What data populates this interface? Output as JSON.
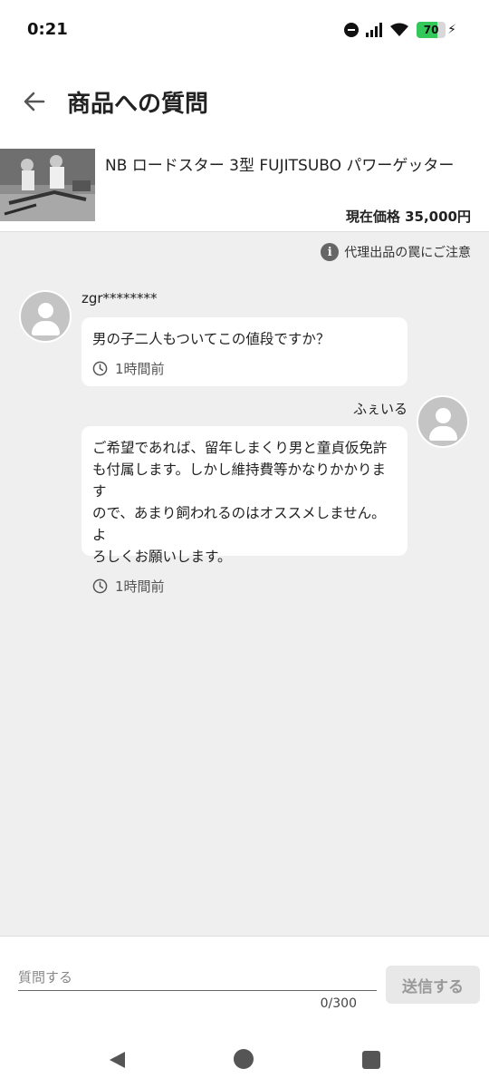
{
  "status_bar": {
    "time": "0:21",
    "battery": "70"
  },
  "header": {
    "title": "商品への質問"
  },
  "product": {
    "name": "NB ロードスター 3型 FUJITSUBO パワーゲッター",
    "price": "現在価格 35,000円"
  },
  "notice": {
    "text": "代理出品の罠にご注意"
  },
  "messages": [
    {
      "user": "zgr********",
      "text_lines": [
        "男の子二人もついてこの値段ですか？"
      ],
      "time": "1時間前"
    },
    {
      "user": "ふぇいる",
      "text_lines": [
        "ご希望であれば、留年しまくり男と童貞仮免許",
        "も付属します。しかし維持費等かなりかかります",
        "ので、あまり飼われるのはオススメしません。よ",
        "ろしくお願いします。"
      ],
      "time": "1時間前"
    }
  ],
  "input": {
    "placeholder": "質問する",
    "value": "",
    "count": "0/300",
    "send_label": "送信する"
  },
  "colors": {
    "accent": "#34c759",
    "background": "#efefef"
  },
  "icons": [
    "back-arrow-icon",
    "info-icon",
    "clock-icon",
    "avatar-icon",
    "nav-back-icon",
    "nav-home-icon",
    "nav-recent-icon"
  ]
}
